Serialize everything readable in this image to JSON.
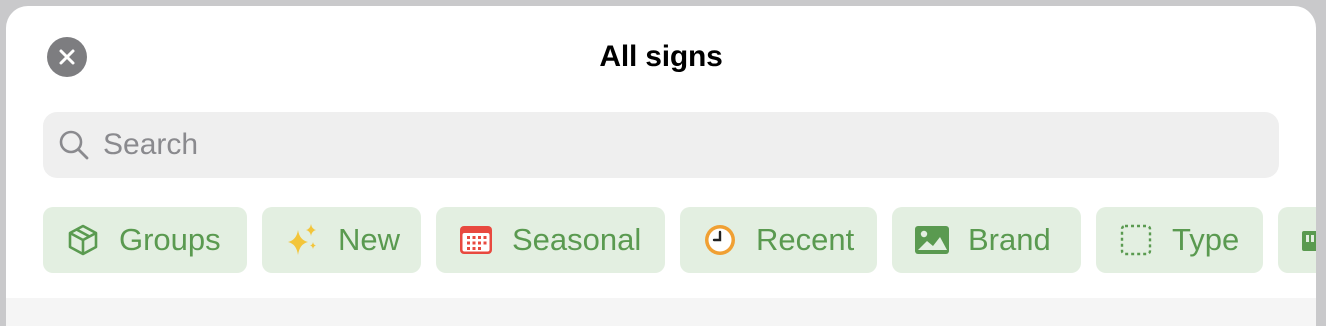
{
  "sheet": {
    "title": "All signs",
    "close_icon": "close-x-icon"
  },
  "search": {
    "placeholder": "Search",
    "value": "",
    "icon": "magnifying-glass-icon"
  },
  "chips": [
    {
      "label": "Groups",
      "icon": "cube-icon",
      "icon_color": "#5a9a50"
    },
    {
      "label": "New",
      "icon": "sparkles-icon",
      "icon_color": "#f3c53a"
    },
    {
      "label": "Seasonal",
      "icon": "calendar-icon",
      "icon_color": "#e8493f"
    },
    {
      "label": "Recent",
      "icon": "clock-icon",
      "icon_color": "#f0a033"
    },
    {
      "label": "Brand",
      "icon": "photo-icon",
      "icon_color": "#5a9a50"
    },
    {
      "label": "Type",
      "icon": "dashed-square-icon",
      "icon_color": "#5a9a50"
    }
  ],
  "colors": {
    "chip_background": "#e3efe1",
    "chip_text": "#5a9a50",
    "search_background": "#efefef",
    "close_button": "#7d7d80"
  }
}
